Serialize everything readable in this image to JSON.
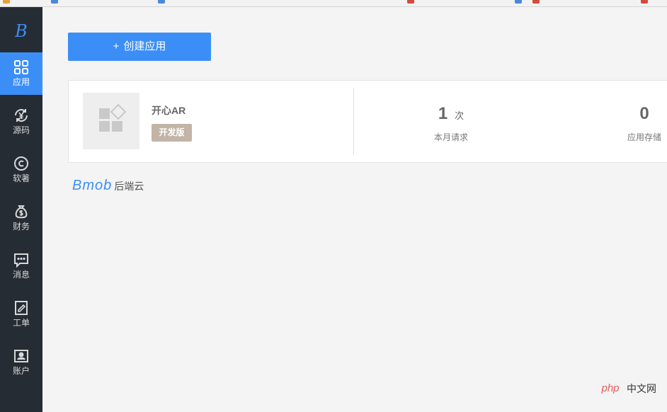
{
  "sidebar": {
    "logo": "B",
    "items": [
      {
        "label": "应用",
        "icon": "grid-icon"
      },
      {
        "label": "源码",
        "icon": "yuan-cycle-icon"
      },
      {
        "label": "软著",
        "icon": "copyright-icon"
      },
      {
        "label": "财务",
        "icon": "money-bag-icon"
      },
      {
        "label": "消息",
        "icon": "message-icon"
      },
      {
        "label": "工单",
        "icon": "edit-document-icon"
      },
      {
        "label": "账户",
        "icon": "account-card-icon"
      }
    ]
  },
  "toolbar": {
    "create_plus": "+",
    "create_label": "创建应用"
  },
  "app_card": {
    "name": "开心AR",
    "badge": "开发版",
    "stats": [
      {
        "value": "1",
        "unit": "次",
        "label": "本月请求"
      },
      {
        "value": "0",
        "unit": "",
        "label": "应用存储"
      }
    ]
  },
  "footer": {
    "brand_logo": "Bmob",
    "brand_text": "后端云"
  },
  "watermark": {
    "logo": "php",
    "text": "中文网"
  },
  "colors": {
    "sidebar_bg": "#262c33",
    "accent": "#3c8ef7",
    "badge": "#c2b4a6"
  }
}
